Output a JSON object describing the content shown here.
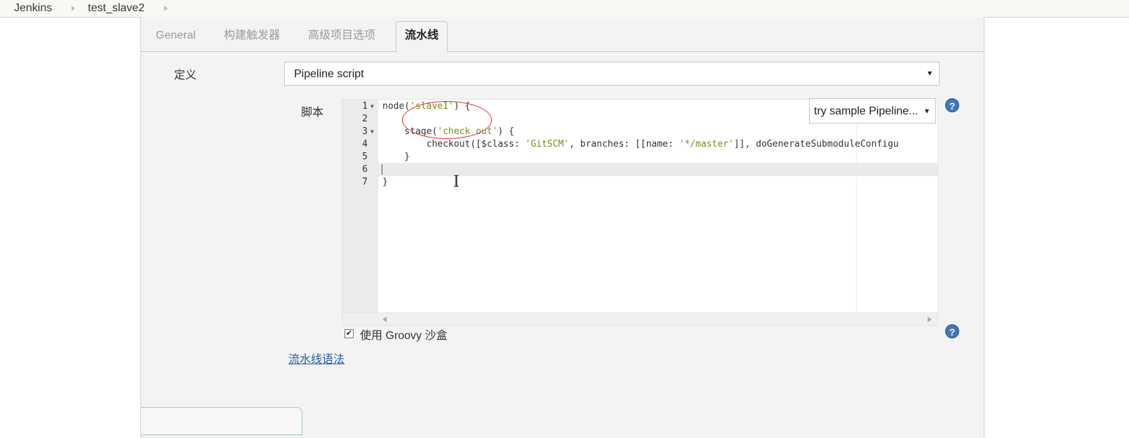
{
  "breadcrumb": {
    "root": "Jenkins",
    "job": "test_slave2"
  },
  "tabs": [
    {
      "label": "General"
    },
    {
      "label": "构建触发器"
    },
    {
      "label": "高级项目选项"
    },
    {
      "label": "流水线"
    }
  ],
  "definition": {
    "label": "定义",
    "value": "Pipeline script"
  },
  "script": {
    "label": "脚本",
    "sample_select": "try sample Pipeline...",
    "lines": [
      {
        "num": "1",
        "parts": [
          "node(",
          "'slave1'",
          ") {"
        ]
      },
      {
        "num": "2",
        "parts": [
          "",
          "",
          ""
        ]
      },
      {
        "num": "3",
        "parts": [
          "    stage(",
          "'check out'",
          ") {"
        ]
      },
      {
        "num": "4",
        "parts": [
          "        checkout([$class: ",
          "'GitSCM'",
          ", branches: [[name: ",
          "'*/master'",
          "]], doGenerateSubmoduleConfigu"
        ]
      },
      {
        "num": "5",
        "parts": [
          "    }",
          "",
          ""
        ]
      },
      {
        "num": "6",
        "parts": [
          "",
          "",
          ""
        ]
      },
      {
        "num": "7",
        "parts": [
          "}",
          "",
          ""
        ]
      }
    ]
  },
  "sandbox": {
    "label": "使用 Groovy 沙盒",
    "checked": true
  },
  "syntax_link": "流水线语法",
  "icons": {
    "help": "?",
    "dropdown": "▾",
    "checkmark": "✔",
    "ibeam": "I"
  },
  "colors": {
    "string_literal": "#7a8a1a",
    "annotation_red": "#e03030",
    "help_blue": "#3d77b8"
  }
}
